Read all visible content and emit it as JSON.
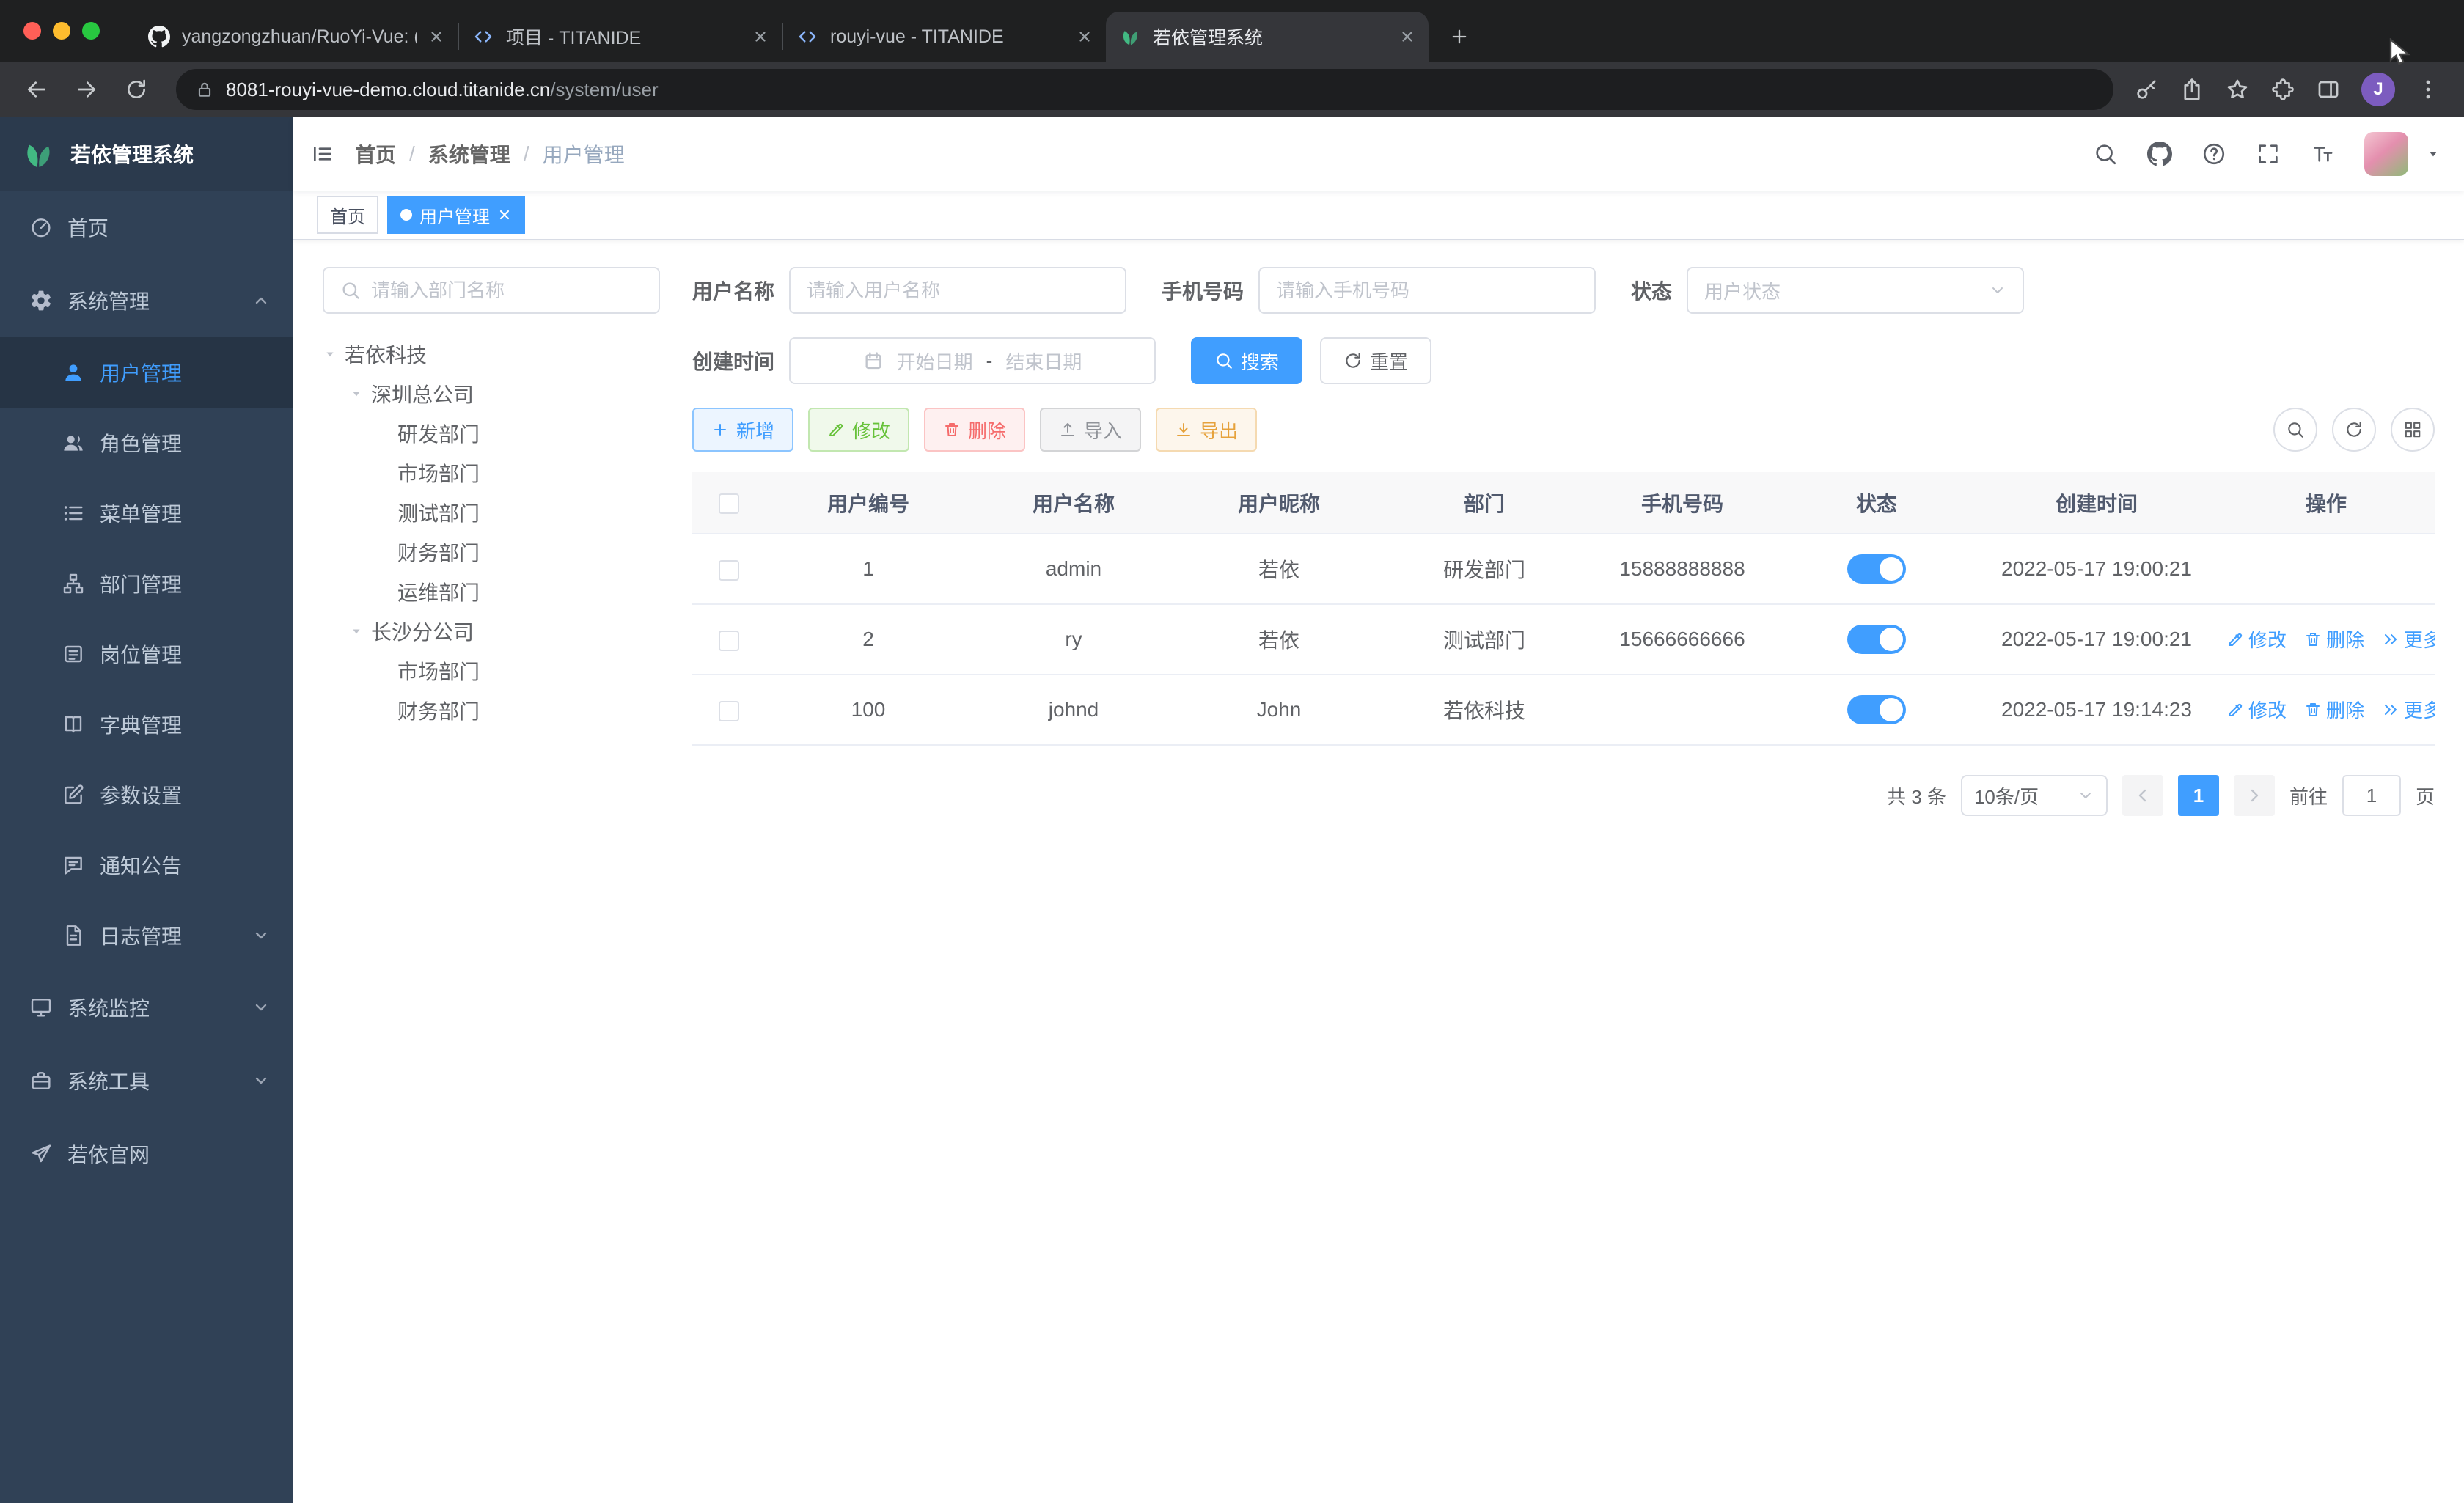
{
  "browser": {
    "tabs": [
      {
        "title": "yangzongzhuan/RuoYi-Vue: (R"
      },
      {
        "title": "项目 - TITANIDE"
      },
      {
        "title": "rouyi-vue - TITANIDE"
      },
      {
        "title": "若依管理系统"
      }
    ],
    "url_host": "8081-rouyi-vue-demo.cloud.titanide.cn",
    "url_path": "/system/user",
    "profile_initial": "J"
  },
  "sidebar": {
    "logo_title": "若依管理系统",
    "items": [
      {
        "label": "首页"
      },
      {
        "label": "系统管理"
      },
      {
        "label": "用户管理"
      },
      {
        "label": "角色管理"
      },
      {
        "label": "菜单管理"
      },
      {
        "label": "部门管理"
      },
      {
        "label": "岗位管理"
      },
      {
        "label": "字典管理"
      },
      {
        "label": "参数设置"
      },
      {
        "label": "通知公告"
      },
      {
        "label": "日志管理"
      },
      {
        "label": "系统监控"
      },
      {
        "label": "系统工具"
      },
      {
        "label": "若依官网"
      }
    ]
  },
  "navbar": {
    "separator": "/",
    "breadcrumb": [
      {
        "label": "首页"
      },
      {
        "label": "系统管理"
      },
      {
        "label": "用户管理"
      }
    ]
  },
  "tags": {
    "items": [
      {
        "label": "首页"
      },
      {
        "label": "用户管理"
      }
    ]
  },
  "dept": {
    "search_placeholder": "请输入部门名称",
    "nodes": [
      {
        "label": "若依科技"
      },
      {
        "label": "深圳总公司"
      },
      {
        "label": "研发部门"
      },
      {
        "label": "市场部门"
      },
      {
        "label": "测试部门"
      },
      {
        "label": "财务部门"
      },
      {
        "label": "运维部门"
      },
      {
        "label": "长沙分公司"
      },
      {
        "label": "市场部门"
      },
      {
        "label": "财务部门"
      }
    ]
  },
  "filters": {
    "username_label": "用户名称",
    "username_placeholder": "请输入用户名称",
    "phone_label": "手机号码",
    "phone_placeholder": "请输入手机号码",
    "status_label": "状态",
    "status_placeholder": "用户状态",
    "date_label": "创建时间",
    "date_start": "开始日期",
    "date_sep": "-",
    "date_end": "结束日期",
    "search": "搜索",
    "reset": "重置"
  },
  "toolbar": {
    "add": "新增",
    "edit": "修改",
    "del": "删除",
    "import": "导入",
    "export": "导出"
  },
  "table": {
    "columns": [
      {
        "label": "用户编号"
      },
      {
        "label": "用户名称"
      },
      {
        "label": "用户昵称"
      },
      {
        "label": "部门"
      },
      {
        "label": "手机号码"
      },
      {
        "label": "状态"
      },
      {
        "label": "创建时间"
      },
      {
        "label": "操作"
      }
    ],
    "rows": [
      {
        "id": "1",
        "username": "admin",
        "nickname": "若依",
        "dept": "研发部门",
        "phone": "15888888888",
        "created": "2022-05-17 19:00:21"
      },
      {
        "id": "2",
        "username": "ry",
        "nickname": "若依",
        "dept": "测试部门",
        "phone": "15666666666",
        "created": "2022-05-17 19:00:21"
      },
      {
        "id": "100",
        "username": "johnd",
        "nickname": "John",
        "dept": "若依科技",
        "phone": "",
        "created": "2022-05-17 19:14:23"
      }
    ],
    "ops": {
      "edit": "修改",
      "del": "删除",
      "more": "更多"
    }
  },
  "pagination": {
    "total": "共 3 条",
    "size": "10条/页",
    "page": "1",
    "goto": "前往",
    "goto_value": "1",
    "unit": "页"
  },
  "theme": {
    "primary": "#409EFF",
    "success": "#67C23A",
    "danger": "#F56C6C",
    "warning": "#E6A23C",
    "info": "#909399",
    "sidebar_bg": "#304156",
    "sidebar_active_bg": "#263445",
    "sidebar_text": "#BFCBD9",
    "switch_on": "#409EFF",
    "tag_active": "#409EFF"
  }
}
